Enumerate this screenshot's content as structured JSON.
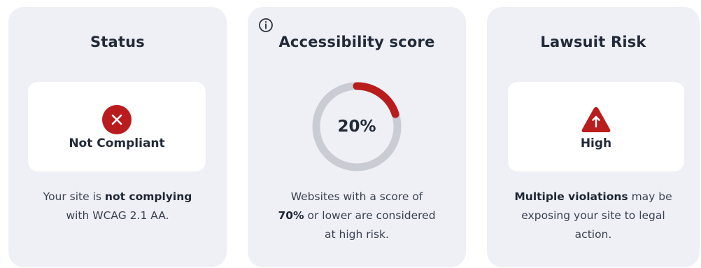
{
  "status": {
    "title": "Status",
    "badge_label": "Not Compliant",
    "badge_icon": "x-circle-icon",
    "desc_prefix": "Your site is ",
    "desc_bold": "not complying",
    "desc_suffix": "with WCAG 2.1 AA."
  },
  "score": {
    "title": "Accessibility score",
    "info_icon": "info-icon",
    "value": 20,
    "value_label": "20%",
    "desc_line1": "Websites with a score of",
    "desc_bold": "70%",
    "desc_line2_suffix": " or lower are considered",
    "desc_line3": "at high risk."
  },
  "risk": {
    "title": "Lawsuit Risk",
    "badge_label": "High",
    "badge_icon": "warning-triangle-arrow-up-icon",
    "desc_bold": "Multiple violations",
    "desc_line1_suffix": " may be",
    "desc_line2": "exposing your site to legal",
    "desc_line3": "action."
  },
  "colors": {
    "card_bg": "#eef0f5",
    "alert_red": "#b91c1c",
    "ring_track": "#c9ccd3",
    "text_dark": "#222a38"
  }
}
